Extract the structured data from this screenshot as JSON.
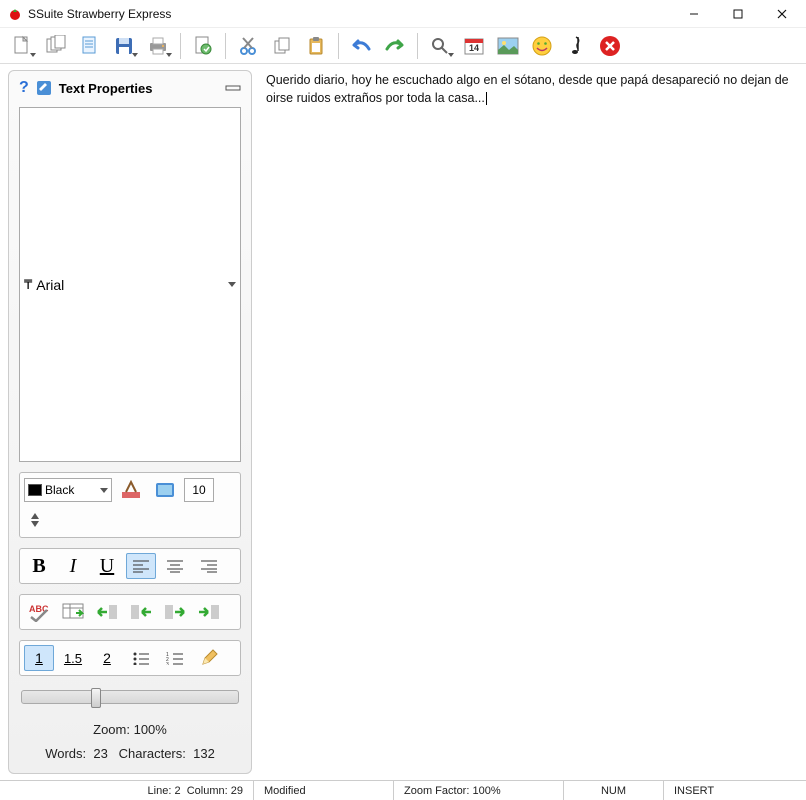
{
  "app": {
    "title": "SSuite Strawberry Express"
  },
  "sidebar": {
    "header_title": "Text Properties",
    "font_name": "Arial",
    "color_name": "Black",
    "font_size": "10",
    "zoom_label": "Zoom: 100%",
    "stat_words_label": "Words:",
    "stat_words_value": "23",
    "stat_chars_label": "Characters:",
    "stat_chars_value": "132"
  },
  "editor": {
    "text": "Querido diario, hoy he escuchado algo en el sótano, desde que papá desapareció no dejan de oirse ruidos extraños por toda la casa..."
  },
  "status": {
    "line_label": "Line:",
    "line_value": "2",
    "col_label": "Column:",
    "col_value": "29",
    "modified": "Modified",
    "zoom": "Zoom Factor: 100%",
    "num": "NUM",
    "insert": "INSERT"
  }
}
